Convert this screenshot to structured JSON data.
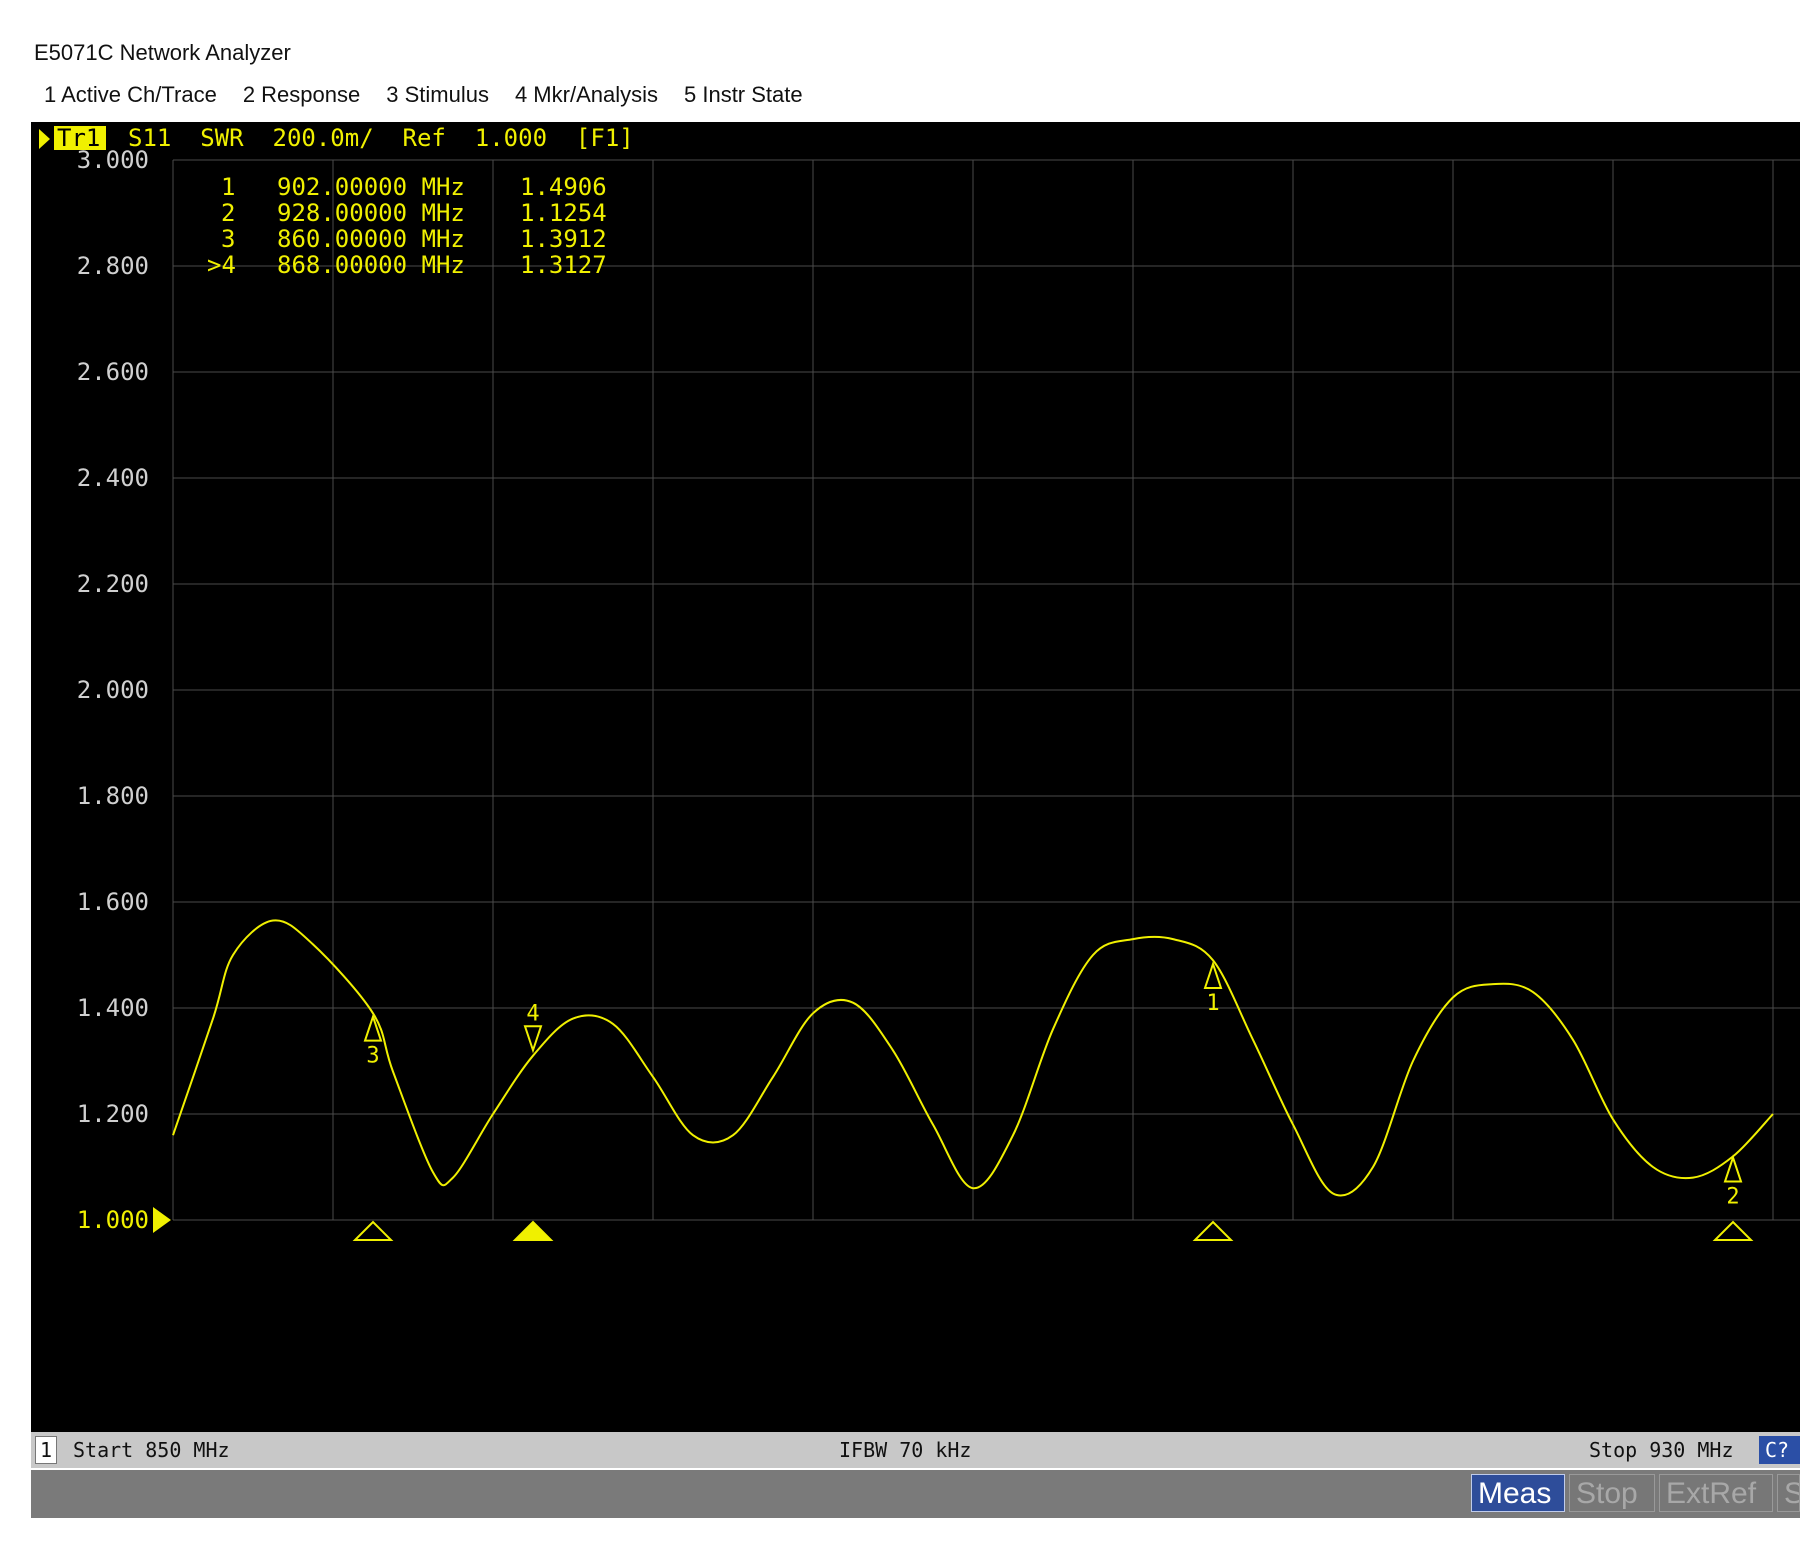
{
  "window": {
    "title": "E5071C Network Analyzer"
  },
  "menu": {
    "items": [
      "1 Active Ch/Trace",
      "2 Response",
      "3 Stimulus",
      "4 Mkr/Analysis",
      "5 Instr State"
    ]
  },
  "trace_header": {
    "trace": "Tr1",
    "text": "S11  SWR  200.0m/  Ref  1.000  [F1]"
  },
  "markers": [
    {
      "label": "1",
      "freq": "902.00000 MHz",
      "value": "1.4906"
    },
    {
      "label": "2",
      "freq": "928.00000 MHz",
      "value": "1.1254"
    },
    {
      "label": "3",
      "freq": "860.00000 MHz",
      "value": "1.3912"
    },
    {
      "label": ">4",
      "freq": "868.00000 MHz",
      "value": "1.3127"
    }
  ],
  "status": {
    "channel": "1",
    "start": "Start 850 MHz",
    "ifbw": "IFBW 70 kHz",
    "stop": "Stop 930 MHz",
    "cal": "C?"
  },
  "instrument_bar": {
    "meas": "Meas",
    "stop": "Stop",
    "extref": "ExtRef",
    "svc": "Svc"
  },
  "colors": {
    "trace": "#f0f000",
    "grid": "#4a4a4a",
    "background": "#000000",
    "text": "#f0f000",
    "axis_text": "#d0d0d0"
  },
  "chart_data": {
    "type": "line",
    "xlabel": "",
    "ylabel": "",
    "xlim": [
      850,
      930
    ],
    "ylim": [
      1.0,
      3.0
    ],
    "y_ticks": [
      "3.000",
      "2.800",
      "2.600",
      "2.400",
      "2.200",
      "2.000",
      "1.800",
      "1.600",
      "1.400",
      "1.200",
      "1.000"
    ],
    "grid": true,
    "series": [
      {
        "x": [
          850,
          852,
          853,
          855,
          857,
          860,
          861,
          863,
          864,
          866,
          868,
          870,
          872,
          874,
          876,
          878,
          880,
          882,
          884,
          886,
          888,
          890,
          892,
          894,
          896,
          898,
          900,
          902,
          904,
          906,
          908,
          910,
          912,
          914,
          916,
          918,
          920,
          922,
          924,
          926,
          928,
          930
        ],
        "y": [
          1.16,
          1.38,
          1.5,
          1.565,
          1.52,
          1.39,
          1.28,
          1.09,
          1.08,
          1.2,
          1.31,
          1.38,
          1.37,
          1.27,
          1.16,
          1.16,
          1.27,
          1.39,
          1.41,
          1.32,
          1.18,
          1.06,
          1.16,
          1.36,
          1.5,
          1.53,
          1.53,
          1.49,
          1.34,
          1.18,
          1.05,
          1.1,
          1.3,
          1.42,
          1.445,
          1.43,
          1.34,
          1.19,
          1.1,
          1.08,
          1.12,
          1.2
        ]
      }
    ],
    "markers": [
      {
        "label": "1",
        "x": 902,
        "y": 1.4906
      },
      {
        "label": "2",
        "x": 928,
        "y": 1.1254
      },
      {
        "label": "3",
        "x": 860,
        "y": 1.3912
      },
      {
        "label": "4",
        "x": 868,
        "y": 1.3127,
        "active": true
      }
    ]
  }
}
